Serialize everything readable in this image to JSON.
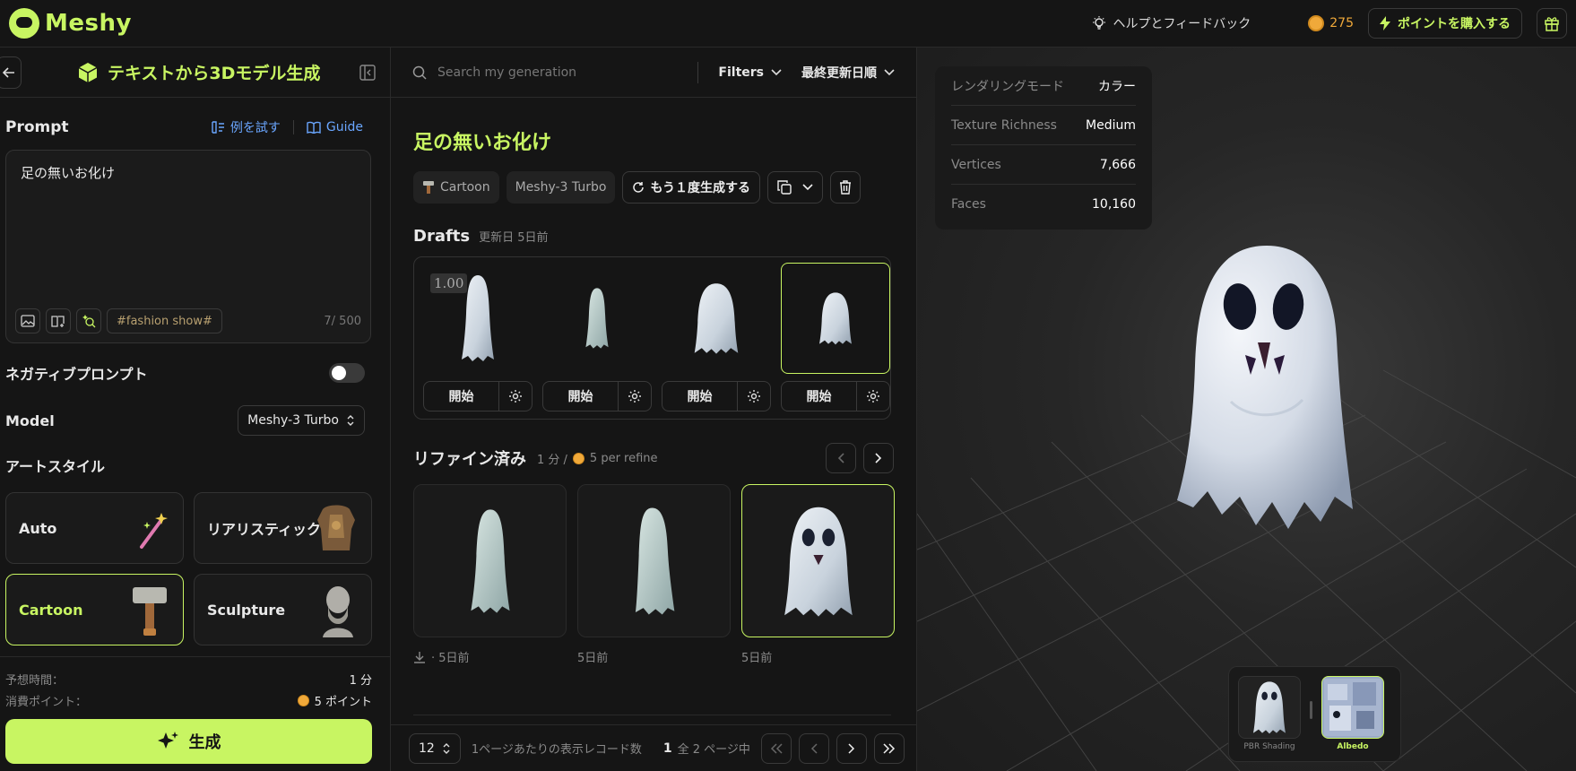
{
  "app": {
    "logo_text": "Meshy"
  },
  "topbar": {
    "help_label": "ヘルプとフィードバック",
    "points": "275",
    "buy_label": "ポイントを購入する"
  },
  "left": {
    "title": "テキストから3Dモデル生成",
    "prompt_label": "Prompt",
    "try_example": "例を試す",
    "guide": "Guide",
    "prompt_value": "足の無いお化け",
    "hashtag": "#fashion show#",
    "char_count": "7/ 500",
    "negative_prompt_label": "ネガティブプロンプト",
    "negative_prompt_enabled": false,
    "model_label": "Model",
    "model_value": "Meshy-3 Turbo",
    "art_style_label": "アートスタイル",
    "styles": [
      {
        "label": "Auto",
        "selected": false
      },
      {
        "label": "リアリスティック",
        "selected": false
      },
      {
        "label": "Cartoon",
        "selected": true
      },
      {
        "label": "Sculpture",
        "selected": false
      }
    ],
    "est_time_label": "予想時間：",
    "est_time_value": "1 分",
    "cost_label": "消費ポイント：",
    "cost_value": "5 ポイント",
    "generate_label": "生成"
  },
  "middle": {
    "search_placeholder": "Search my generation",
    "filters_label": "Filters",
    "sort_label": "最終更新日順",
    "generation_title": "足の無いお化け",
    "chips": {
      "style": "Cartoon",
      "model": "Meshy-3 Turbo",
      "regenerate": "もう１度生成する"
    },
    "drafts_title": "Drafts",
    "drafts_updated": "更新日 5日前",
    "draft_badge": "1.00",
    "start_label": "開始",
    "refined_title": "リファイン済み",
    "refined_meta": "1 分 /",
    "refined_cost": "5 per refine",
    "refined": [
      {
        "meta": "· 5日前"
      },
      {
        "meta": "5日前"
      },
      {
        "meta": "5日前"
      }
    ],
    "per_page": "12",
    "per_page_label": "1ページあたりの表示レコード数",
    "page_current": "1",
    "page_total": "全 2 ページ中"
  },
  "viewer": {
    "rows": [
      {
        "key": "レンダリングモード",
        "value": "カラー"
      },
      {
        "key": "Texture Richness",
        "value": "Medium"
      },
      {
        "key": "Vertices",
        "value": "7,666"
      },
      {
        "key": "Faces",
        "value": "10,160"
      }
    ],
    "materials": [
      {
        "label": "PBR Shading",
        "selected": false
      },
      {
        "label": "Albedo",
        "selected": true
      }
    ]
  },
  "colors": {
    "accent": "#c8f562",
    "background": "#151515",
    "link": "#6aa6ff",
    "coin": "#f0a93a"
  }
}
